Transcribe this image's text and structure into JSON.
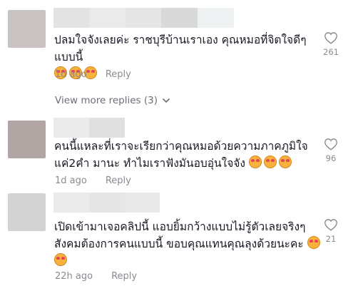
{
  "comments": [
    {
      "text": "ปลมใจจังเลยค่ะ ราชบุรีบ้านเราเอง คุณหมอที่จิตใจดีๆแบบนี้",
      "time": "1d ago",
      "reply": "Reply",
      "likes": "261",
      "emoji_count": 3,
      "name_colors": [
        "#e3e3e3",
        "#eaeaea",
        "#e6e6e6",
        "#d9d9d9",
        "#eef2f2"
      ],
      "avatar_color": "#c9c4c3"
    },
    {
      "text": "คนนี้แหละที่เราจะเรียกว่าคุณหมอด้วยความภาคภูมิใจ แค่2คำ มานะ ทำไมเราฟังมันอบอุ่นใจจัง",
      "time": "1d ago",
      "reply": "Reply",
      "likes": "96",
      "emoji_count": 3,
      "name_colors": [
        "#ebebeb",
        "#e0e0e0"
      ],
      "avatar_color": "#b1a6a4"
    },
    {
      "text": "เปิดเข้ามาเจอคลิปนี้ แอบยิ้มกว้างแบบไม่รู้ตัวเลยจริงๆ สังคมต้องการคนแบบนี้ ขอบคุณแทนคุณลุงด้วยนะคะ",
      "time": "22h ago",
      "reply": "Reply",
      "likes": "21",
      "emoji_count": 2,
      "name_colors": [
        "#ebebeb",
        "#e6e6e6",
        "#e9e9e9"
      ],
      "avatar_color": "#d2d2d2"
    }
  ],
  "view_more": "View more replies (3)",
  "icons": {
    "like": "heart-outline-icon",
    "expand": "chevron-down-icon",
    "emoji": "smiling-face-with-hearts-emoji"
  }
}
